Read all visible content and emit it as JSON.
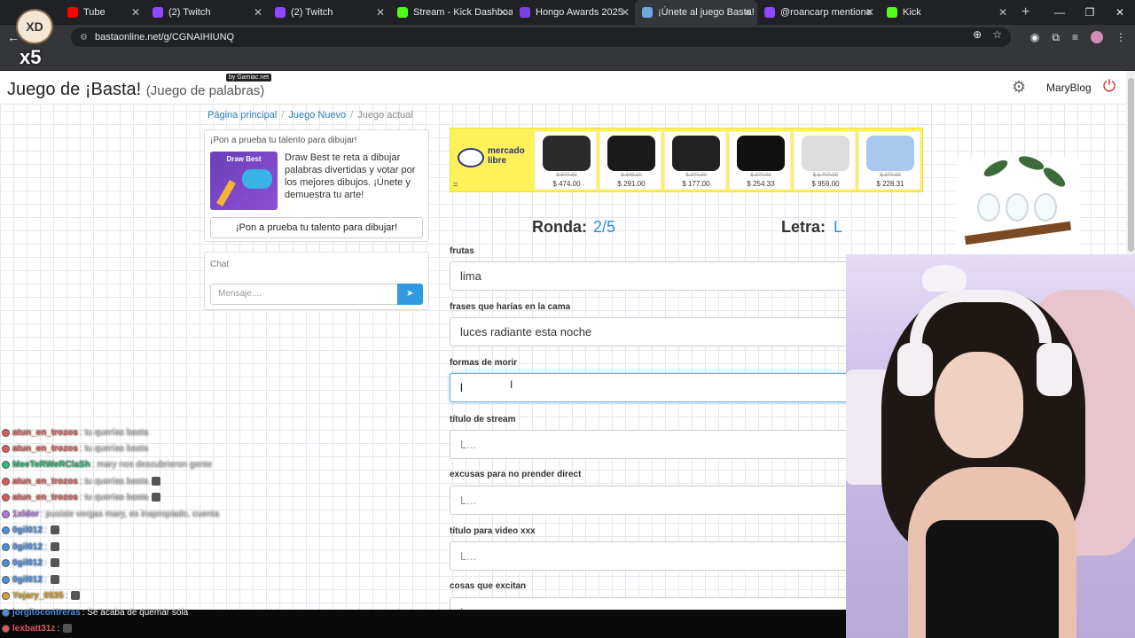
{
  "browser": {
    "tabs": [
      {
        "label": "Tube",
        "color": "#ff0000",
        "active": false
      },
      {
        "label": "(2) Twitch",
        "color": "#9146ff",
        "active": false
      },
      {
        "label": "(2) Twitch",
        "color": "#9146ff",
        "active": false
      },
      {
        "label": "Stream - Kick Dashboard",
        "color": "#53fc18",
        "active": false
      },
      {
        "label": "Hongo Awards 2025",
        "color": "#7b3fe4",
        "active": false
      },
      {
        "label": "¡Únete al juego Basta!",
        "color": "#6fa8dc",
        "active": true
      },
      {
        "label": "@roancarp mentione",
        "color": "#9146ff",
        "active": false
      },
      {
        "label": "Kick",
        "color": "#53fc18",
        "active": false
      }
    ],
    "url": "bastaonline.net/g/CGNAIHIUNQ"
  },
  "header": {
    "title": "Juego de ¡Basta!",
    "subtitle": "(Juego de palabras)",
    "badge": "by Gamiac.net",
    "user": "MaryBlog"
  },
  "breadcrumb": {
    "home": "Página principal",
    "new_game": "Juego Nuevo",
    "current": "Juego actual"
  },
  "promo": {
    "heading": "¡Pon a prueba tu talento para dibujar!",
    "image_title": "Draw Best",
    "text": "Draw Best te reta a dibujar palabras divertidas y votar por los mejores dibujos. ¡Únete y demuestra tu arte!",
    "button": "¡Pon a prueba tu talento para dibujar!"
  },
  "chat": {
    "title": "Chat",
    "placeholder": "Mensaje...."
  },
  "ad": {
    "brand": "mercado libre",
    "eq": "=",
    "products": [
      {
        "old": "$ 6??.00",
        "price": "$ 474.00",
        "color": "#2b2b2b"
      },
      {
        "old": "$ 349.00",
        "price": "$ 291.00",
        "color": "#1a1a1a"
      },
      {
        "old": "$ 2??.00",
        "price": "$ 177.00",
        "color": "#222222"
      },
      {
        "old": "$ 3??.00",
        "price": "$ 254.33",
        "color": "#111111"
      },
      {
        "old": "$ 1.???.00",
        "price": "$ 959.00",
        "color": "#dcdcdc"
      },
      {
        "old": "$ 2??.00",
        "price": "$ 228.31",
        "color": "#a8c8ef"
      }
    ]
  },
  "game": {
    "round_label": "Ronda:",
    "round_value": "2/5",
    "letter_label": "Letra:",
    "letter_value": "L",
    "fields": [
      {
        "label": "frutas",
        "value": "lima",
        "placeholder": false
      },
      {
        "label": "frases que harías en la cama",
        "value": "luces radiante esta noche",
        "placeholder": false
      },
      {
        "label": "formas de morir",
        "value": "l",
        "placeholder": false
      },
      {
        "label": "título de stream",
        "value": "L...",
        "placeholder": true
      },
      {
        "label": "excusas para no prender direct",
        "value": "L...",
        "placeholder": true
      },
      {
        "label": "título para video xxx",
        "value": "L...",
        "placeholder": true
      },
      {
        "label": "cosas que excitan",
        "value": "L...",
        "placeholder": true
      }
    ]
  },
  "stream_chat": [
    {
      "nick": "atun_en_trozos",
      "msg": ": tu querías basta",
      "color": "#e05a5a"
    },
    {
      "nick": "atun_en_trozos",
      "msg": ": tu querías basta",
      "color": "#e05a5a"
    },
    {
      "nick": "MeeTeRWeRClaSh",
      "msg": ": mary nos descubrieron gente",
      "color": "#2fb877"
    },
    {
      "nick": "atun_en_trozos",
      "msg": ": tu querías basta",
      "color": "#e05a5a"
    },
    {
      "nick": "atun_en_trozos",
      "msg": ": tu querías basta",
      "color": "#e05a5a"
    },
    {
      "nick": "1xldor",
      "msg": ": pusiste vergas mary, es inapropiado, cuenta",
      "color": "#b07ae0"
    },
    {
      "nick": "0gil012",
      "msg": ":",
      "color": "#4a90e2"
    },
    {
      "nick": "0gil012",
      "msg": ":",
      "color": "#4a90e2"
    },
    {
      "nick": "0gil012",
      "msg": ":",
      "color": "#4a90e2"
    },
    {
      "nick": "0gil012",
      "msg": ":",
      "color": "#4a90e2"
    },
    {
      "nick": "Yojary_0535",
      "msg": ":",
      "color": "#d4a030"
    },
    {
      "nick": "jorgitocontreras",
      "msg": ": Se acaba de quemar sola",
      "color": "#4a90e2"
    },
    {
      "nick": "lexbatt31z",
      "msg": ":",
      "color": "#e05a5a"
    }
  ],
  "overlay": {
    "avatar_text": "XD",
    "multiplier": "x5"
  }
}
